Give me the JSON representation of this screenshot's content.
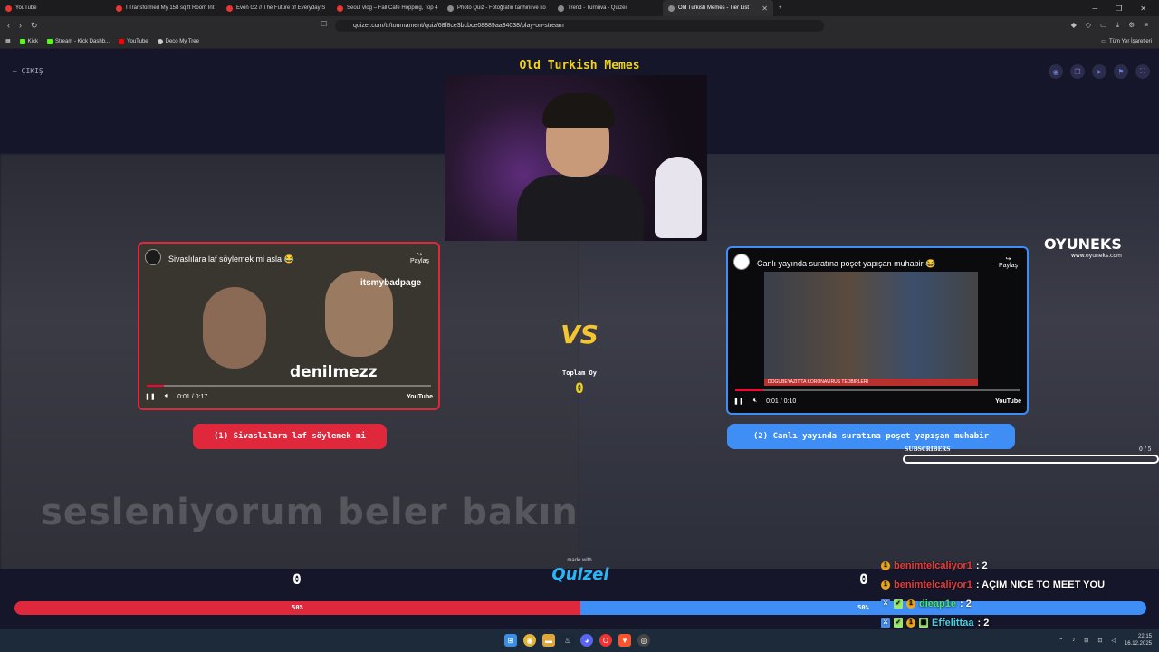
{
  "browser": {
    "tabs": [
      {
        "label": "YouTube",
        "active": false
      },
      {
        "label": "I Transformed My 158 sq ft Room Int",
        "active": false
      },
      {
        "label": "Even G2 // The Future of Everyday S",
        "active": false
      },
      {
        "label": "Seoul vlog – Fall Cafe Hopping, Top 4",
        "active": false
      },
      {
        "label": "Photo Quiz - Fotoğrafın tarihini ve ko",
        "active": false
      },
      {
        "label": "Trend - Turnuva - Quizei",
        "active": false
      },
      {
        "label": "Old Turkish Memes - Tier List",
        "active": true
      }
    ],
    "url": "quizei.com/tr/tournament/quiz/68f8ce3bcbce08889aa34038/play-on-stream",
    "bookmarks": [
      {
        "label": "Kick",
        "color": "#53fc18"
      },
      {
        "label": "Stream - Kick Dashb...",
        "color": "#53fc18"
      },
      {
        "label": "YouTube",
        "color": "#ff0000"
      },
      {
        "label": "Deco My Tree",
        "color": "#cccccc"
      }
    ],
    "bookmarks_right": "Tüm Yer İşaretleri"
  },
  "page": {
    "exit_label": "ÇIKIŞ",
    "title": "Old Turkish Memes",
    "background_text": "sesleniyorum beler bakın"
  },
  "left_video": {
    "title": "Sivaslılara laf söylemek mi asla 😂",
    "share_label": "Paylaş",
    "watermark": "itsmybadpage",
    "caption": "denilmezz",
    "time": "0:01 / 0:17",
    "progress": 0.06,
    "brand": "YouTube"
  },
  "right_video": {
    "title": "Canlı yayında suratına poşet yapışan muhabir 😂",
    "share_label": "Paylaş",
    "ticker": "DOĞUBEYAZIT'TA KORONAVİRÜS TEDBİRLERİ",
    "time": "0:01 / 0:10",
    "progress": 0.1,
    "brand": "YouTube"
  },
  "options": {
    "left_label": "(1) Sivaslılara laf söylemek mi",
    "right_label": "(2) Canlı yayında suratına poşet yapışan muhabir"
  },
  "center": {
    "vs": "VS",
    "total_label": "Toplam Oy",
    "total_value": "0"
  },
  "overlay": {
    "brand_name": "OYUNEKS",
    "brand_url": "www.oyuneks.com",
    "subs_label": "SUBSCRIBERS",
    "subs_count": "0 / 5"
  },
  "footer": {
    "made_with": "made with",
    "logo": "Quizei",
    "score_left": "0",
    "score_right": "0",
    "pct_left": "50%",
    "pct_right": "50%"
  },
  "chat": [
    {
      "user": "benimtelcaliyor1",
      "message": ": 2",
      "user_color": "#e83a3a"
    },
    {
      "user": "benimtelcaliyor1",
      "message": ": AÇIM NICE TO MEET YOU",
      "user_color": "#e83a3a"
    },
    {
      "user": "dieap1e",
      "message": ": 2",
      "user_color": "#4ee17a"
    },
    {
      "user": "Effelittaa",
      "message": ": 2",
      "user_color": "#45d2e8"
    }
  ],
  "taskbar": {
    "time": "22:15",
    "date": "16.12.2025"
  }
}
